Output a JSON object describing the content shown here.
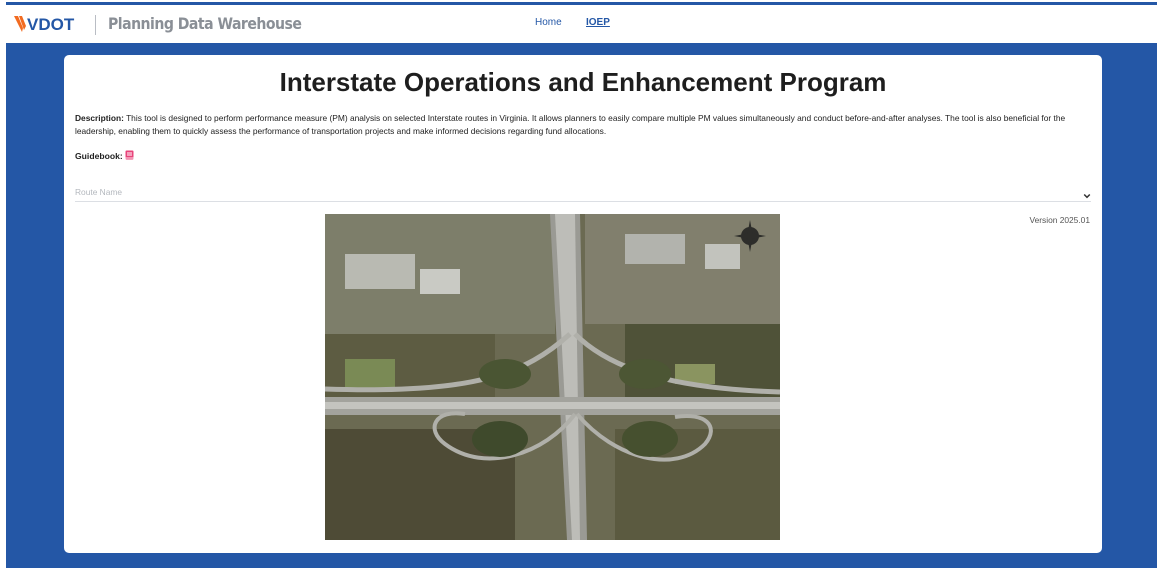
{
  "nav": {
    "logo_text": "VDOT",
    "app_title": "Planning Data Warehouse",
    "links": [
      {
        "label": "Home",
        "active": false
      },
      {
        "label": "IOEP",
        "active": true
      }
    ]
  },
  "page": {
    "title": "Interstate Operations and Enhancement Program",
    "description_label": "Description:",
    "description_text": "This tool is designed to perform performance measure (PM) analysis on selected Interstate routes in Virginia. It allows planners to easily compare multiple PM values simultaneously and conduct before-and-after analyses. The tool is also beneficial for the leadership, enabling them to quickly assess the performance of transportation projects and make informed decisions regarding fund allocations.",
    "guidebook_label": "Guidebook:",
    "guidebook_icon": "book-icon",
    "route_select": {
      "placeholder": "Route Name",
      "value": ""
    },
    "version": "Version 2025.01",
    "image_subject": "aerial-interchange-photo"
  },
  "colors": {
    "brand_blue": "#2457a6",
    "logo_orange": "#f26b21",
    "guidebook_pink": "#e8437a"
  }
}
